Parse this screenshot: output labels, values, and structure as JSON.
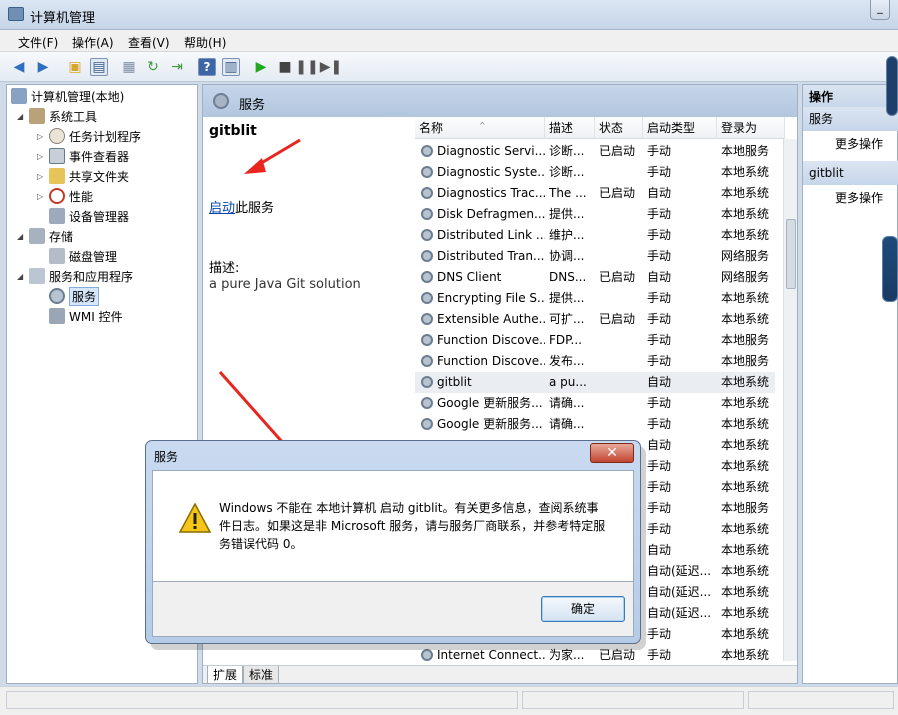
{
  "window": {
    "title": "计算机管理"
  },
  "menu": [
    "文件(F)",
    "操作(A)",
    "查看(V)",
    "帮助(H)"
  ],
  "tree": {
    "root": "计算机管理(本地)",
    "items": [
      {
        "label": "系统工具"
      },
      {
        "label": "任务计划程序"
      },
      {
        "label": "事件查看器"
      },
      {
        "label": "共享文件夹"
      },
      {
        "label": "性能"
      },
      {
        "label": "设备管理器"
      },
      {
        "label": "存储"
      },
      {
        "label": "磁盘管理"
      },
      {
        "label": "服务和应用程序"
      },
      {
        "label": "服务"
      },
      {
        "label": "WMI 控件"
      }
    ]
  },
  "center": {
    "title": "服务",
    "detail": {
      "service_name": "gitblit",
      "start_link": "启动",
      "start_suffix": "此服务",
      "desc_label": "描述:",
      "desc": "a pure Java Git solution"
    },
    "columns": [
      "名称",
      "描述",
      "状态",
      "启动类型",
      "登录为"
    ],
    "rows": [
      {
        "name": "Diagnostic Servi...",
        "desc": "诊断...",
        "status": "已启动",
        "start": "手动",
        "logon": "本地服务"
      },
      {
        "name": "Diagnostic Syste...",
        "desc": "诊断...",
        "status": "",
        "start": "手动",
        "logon": "本地系统"
      },
      {
        "name": "Diagnostics Trac...",
        "desc": "The ...",
        "status": "已启动",
        "start": "自动",
        "logon": "本地系统"
      },
      {
        "name": "Disk Defragmen...",
        "desc": "提供...",
        "status": "",
        "start": "手动",
        "logon": "本地系统"
      },
      {
        "name": "Distributed Link ...",
        "desc": "维护...",
        "status": "",
        "start": "手动",
        "logon": "本地系统"
      },
      {
        "name": "Distributed Tran...",
        "desc": "协调...",
        "status": "",
        "start": "手动",
        "logon": "网络服务"
      },
      {
        "name": "DNS Client",
        "desc": "DNS...",
        "status": "已启动",
        "start": "自动",
        "logon": "网络服务"
      },
      {
        "name": "Encrypting File S...",
        "desc": "提供...",
        "status": "",
        "start": "手动",
        "logon": "本地系统"
      },
      {
        "name": "Extensible Authe...",
        "desc": "可扩...",
        "status": "已启动",
        "start": "手动",
        "logon": "本地系统"
      },
      {
        "name": "Function Discove...",
        "desc": "FDP...",
        "status": "",
        "start": "手动",
        "logon": "本地服务"
      },
      {
        "name": "Function Discove...",
        "desc": "发布...",
        "status": "",
        "start": "手动",
        "logon": "本地服务"
      },
      {
        "name": "gitblit",
        "desc": "a pu...",
        "status": "",
        "start": "自动",
        "logon": "本地系统"
      },
      {
        "name": "Google 更新服务...",
        "desc": "请确...",
        "status": "",
        "start": "手动",
        "logon": "本地系统"
      },
      {
        "name": "Google 更新服务...",
        "desc": "请确...",
        "status": "",
        "start": "手动",
        "logon": "本地系统"
      },
      {
        "name": "",
        "desc": "",
        "status": "",
        "start": "自动",
        "logon": "本地系统"
      },
      {
        "name": "",
        "desc": "",
        "status": "",
        "start": "手动",
        "logon": "本地系统"
      },
      {
        "name": "",
        "desc": "",
        "status": "",
        "start": "手动",
        "logon": "本地系统"
      },
      {
        "name": "",
        "desc": "",
        "status": "",
        "start": "手动",
        "logon": "本地服务"
      },
      {
        "name": "",
        "desc": "",
        "status": "",
        "start": "手动",
        "logon": "本地系统"
      },
      {
        "name": "",
        "desc": "",
        "status": "",
        "start": "自动",
        "logon": "本地系统"
      },
      {
        "name": "",
        "desc": "",
        "status": "",
        "start": "自动(延迟...",
        "logon": "本地系统"
      },
      {
        "name": "",
        "desc": "",
        "status": "",
        "start": "自动(延迟...",
        "logon": "本地系统"
      },
      {
        "name": "",
        "desc": "",
        "status": "",
        "start": "自动(延迟...",
        "logon": "本地系统"
      },
      {
        "name": "",
        "desc": "",
        "status": "",
        "start": "手动",
        "logon": "本地系统"
      },
      {
        "name": "Internet Connect...",
        "desc": "为家...",
        "status": "已启动",
        "start": "手动",
        "logon": "本地系统"
      }
    ],
    "tabs": [
      "扩展",
      "标准"
    ]
  },
  "actions": {
    "title": "操作",
    "sections": [
      {
        "title": "服务",
        "item": "更多操作"
      },
      {
        "title": "gitblit",
        "item": "更多操作"
      }
    ]
  },
  "dialog": {
    "title": "服务",
    "close_glyph": "✕",
    "message": "Windows 不能在 本地计算机 启动 gitblit。有关更多信息，查阅系统事件日志。如果这是非 Microsoft 服务，请与服务厂商联系，并参考特定服务错误代码 0。",
    "ok_label": "确定"
  },
  "colors": {
    "header_blue": "#c6d6ea",
    "selection": "#d6e7fa",
    "link": "#0645ad",
    "arrow_red": "#e8251f"
  }
}
